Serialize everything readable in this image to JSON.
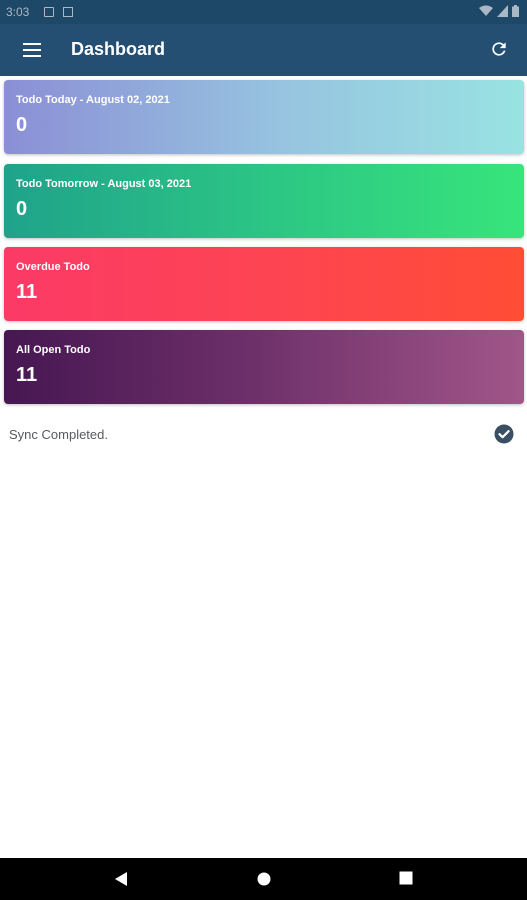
{
  "status_bar": {
    "time": "3:03"
  },
  "app_bar": {
    "title": "Dashboard"
  },
  "cards": [
    {
      "label": "Todo Today - August 02, 2021",
      "count": "0"
    },
    {
      "label": "Todo Tomorrow - August 03, 2021",
      "count": "0"
    },
    {
      "label": "Overdue Todo",
      "count": "11"
    },
    {
      "label": "All Open Todo",
      "count": "11"
    }
  ],
  "sync": {
    "text": "Sync Completed."
  },
  "colors": {
    "status_bar": "#1e4868",
    "app_bar": "#254f72",
    "check": "#3a4f63"
  },
  "icons": {
    "menu": "menu-icon",
    "refresh": "refresh-icon",
    "check": "check-circle-icon",
    "back": "back-icon",
    "home": "home-icon",
    "recents": "recents-icon"
  }
}
